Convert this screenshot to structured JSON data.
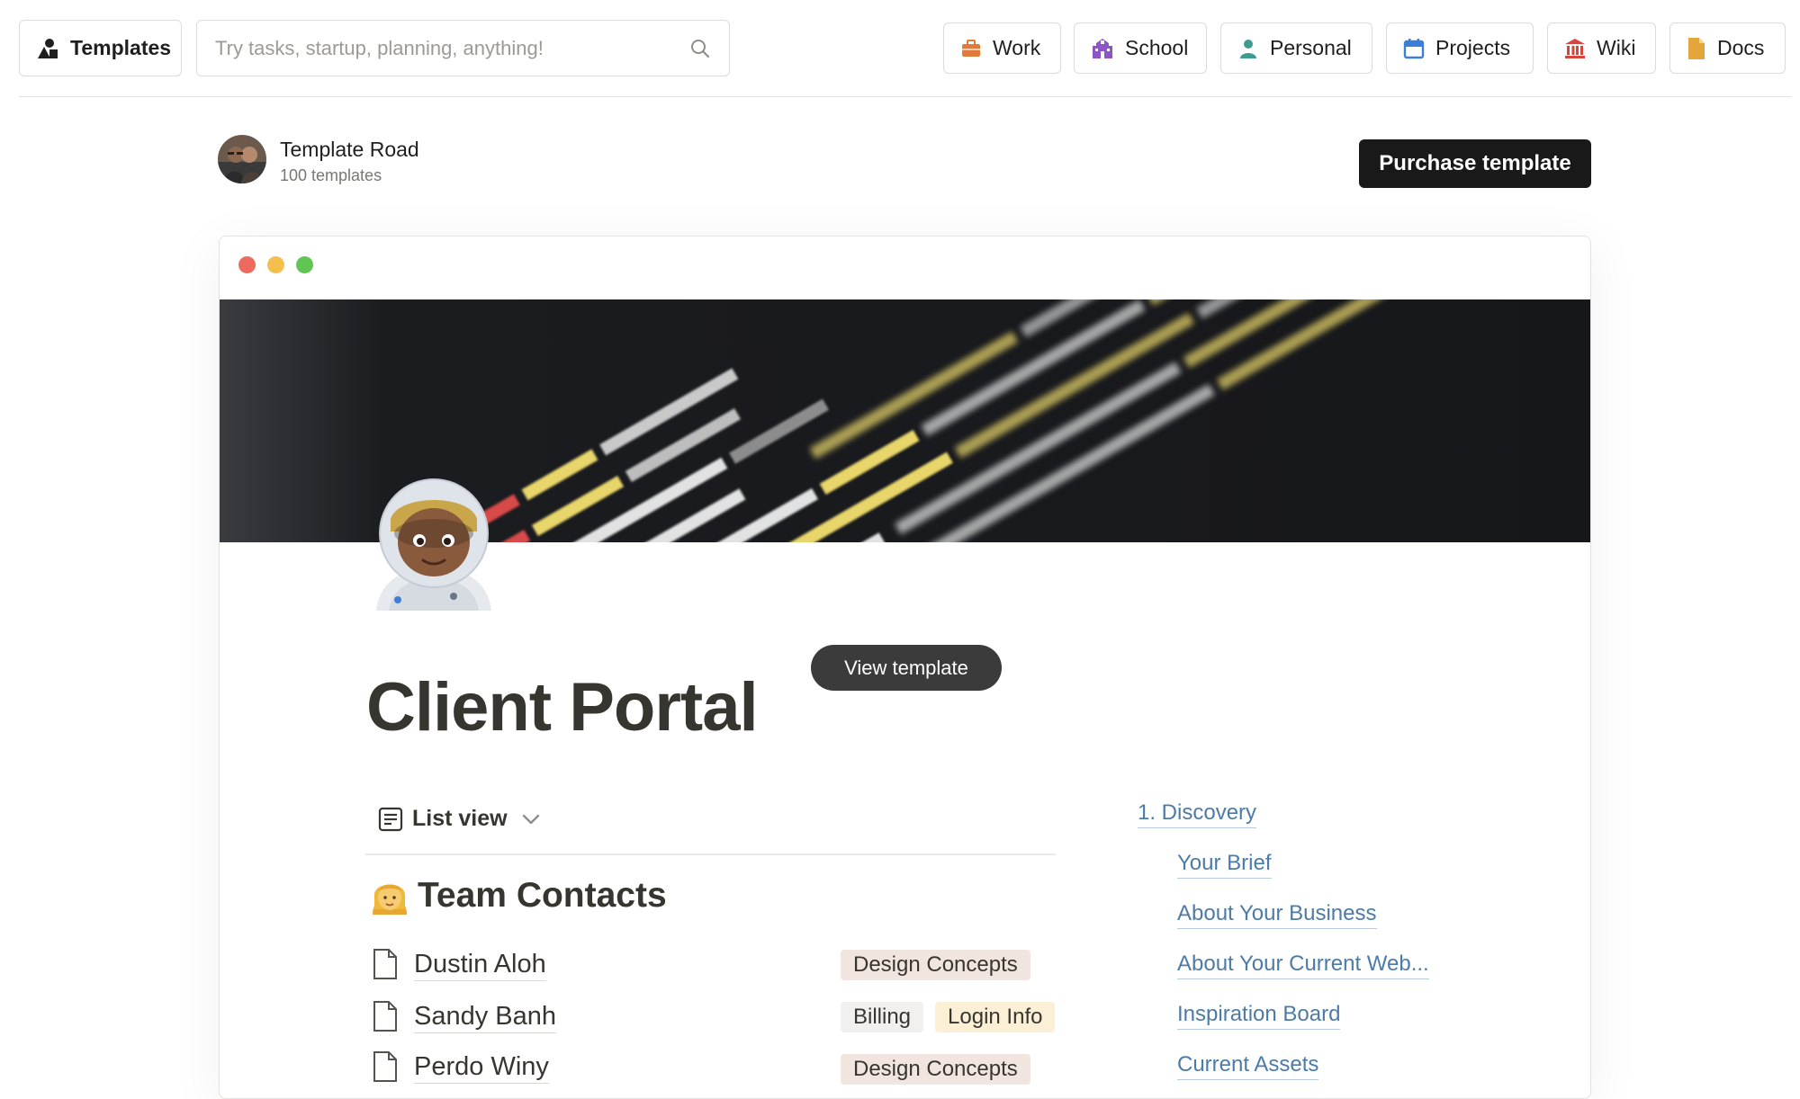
{
  "nav": {
    "templates_label": "Templates",
    "search_placeholder": "Try tasks, startup, planning, anything!",
    "categories": [
      {
        "label": "Work",
        "icon": "briefcase-icon",
        "color": "#e07b39"
      },
      {
        "label": "School",
        "icon": "school-icon",
        "color": "#8e55c9"
      },
      {
        "label": "Personal",
        "icon": "person-icon",
        "color": "#3f9a8f"
      },
      {
        "label": "Projects",
        "icon": "calendar-icon",
        "color": "#3c7fd9"
      },
      {
        "label": "Wiki",
        "icon": "bank-icon",
        "color": "#d6453d"
      },
      {
        "label": "Docs",
        "icon": "document-icon",
        "color": "#e4a53a"
      }
    ]
  },
  "creator": {
    "name": "Template Road",
    "count": "100 templates"
  },
  "purchase_label": "Purchase template",
  "preview": {
    "view_template_label": "View template",
    "title": "Client Portal",
    "list_view_label": "List view",
    "section_title": "Team Contacts",
    "rows": [
      {
        "name": "Dustin Aloh",
        "tags": [
          {
            "label": "Design Concepts",
            "color": "#f1e5df"
          }
        ]
      },
      {
        "name": "Sandy Banh",
        "tags": [
          {
            "label": "Billing",
            "color": "#f1f0ef"
          },
          {
            "label": "Login Info",
            "color": "#fbefd6"
          }
        ]
      },
      {
        "name": "Perdo Winy",
        "tags": [
          {
            "label": "Design Concepts",
            "color": "#f1e5df"
          }
        ]
      }
    ],
    "toc": [
      {
        "label": "1. Discovery",
        "level": 0
      },
      {
        "label": "Your Brief",
        "level": 1
      },
      {
        "label": "About Your Business",
        "level": 1
      },
      {
        "label": "About Your Current Web...",
        "level": 1
      },
      {
        "label": "Inspiration Board",
        "level": 1
      },
      {
        "label": "Current Assets",
        "level": 1
      }
    ]
  },
  "colors": {
    "accent": "#191919",
    "link": "#4d7ba7",
    "window_dots": [
      "#ec6a5e",
      "#f4bf4f",
      "#61c554"
    ]
  }
}
